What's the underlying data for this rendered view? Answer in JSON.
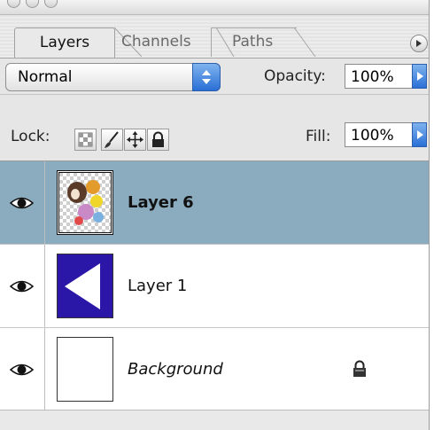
{
  "tabs": [
    {
      "label": "Layers",
      "active": true
    },
    {
      "label": "Channels",
      "active": false
    },
    {
      "label": "Paths",
      "active": false
    }
  ],
  "blend": {
    "mode": "Normal"
  },
  "opacity": {
    "label": "Opacity:",
    "value": "100%"
  },
  "lock": {
    "label": "Lock:"
  },
  "fill": {
    "label": "Fill:",
    "value": "100%"
  },
  "layers": [
    {
      "name": "Layer 6",
      "visible": true,
      "selected": true
    },
    {
      "name": "Layer 1",
      "visible": true,
      "selected": false
    },
    {
      "name": "Background",
      "visible": true,
      "selected": false,
      "locked": true
    }
  ],
  "colors": {
    "selection": "#8bacbf",
    "accent": "#2a6fd6",
    "layer1_fill": "#2a17a8"
  }
}
